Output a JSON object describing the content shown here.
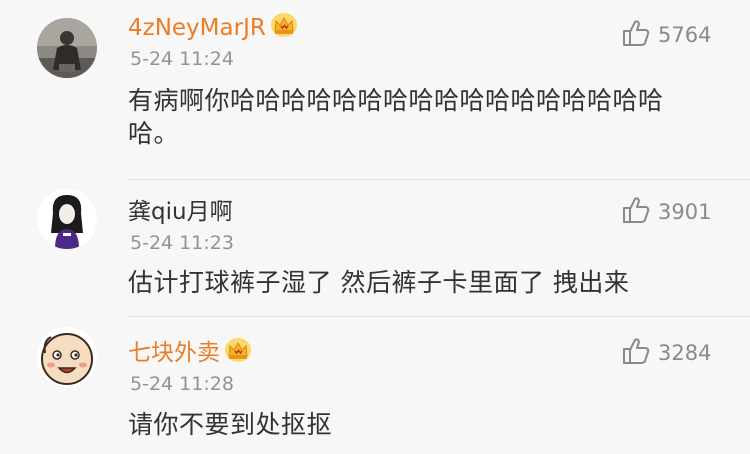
{
  "comments": [
    {
      "username": "4zNeyMarJR",
      "vip": true,
      "time": "5-24 11:24",
      "likes": "5764",
      "content": "有病啊你哈哈哈哈哈哈哈哈哈哈哈哈哈哈哈哈哈哈。"
    },
    {
      "username": "龚qiu月啊",
      "vip": false,
      "time": "5-24 11:23",
      "likes": "3901",
      "content": "估计打球裤子湿了 然后裤子卡里面了 拽出来"
    },
    {
      "username": "七块外卖",
      "vip": true,
      "time": "5-24 11:28",
      "likes": "3284",
      "content": "请你不要到处抠抠"
    }
  ],
  "colors": {
    "vip_name": "#ea7d26",
    "normal_name": "#333333",
    "meta": "#939393",
    "background": "#f7f7f7"
  },
  "icons": {
    "vip_badge": "crown-icon",
    "like": "thumbs-up-icon"
  }
}
